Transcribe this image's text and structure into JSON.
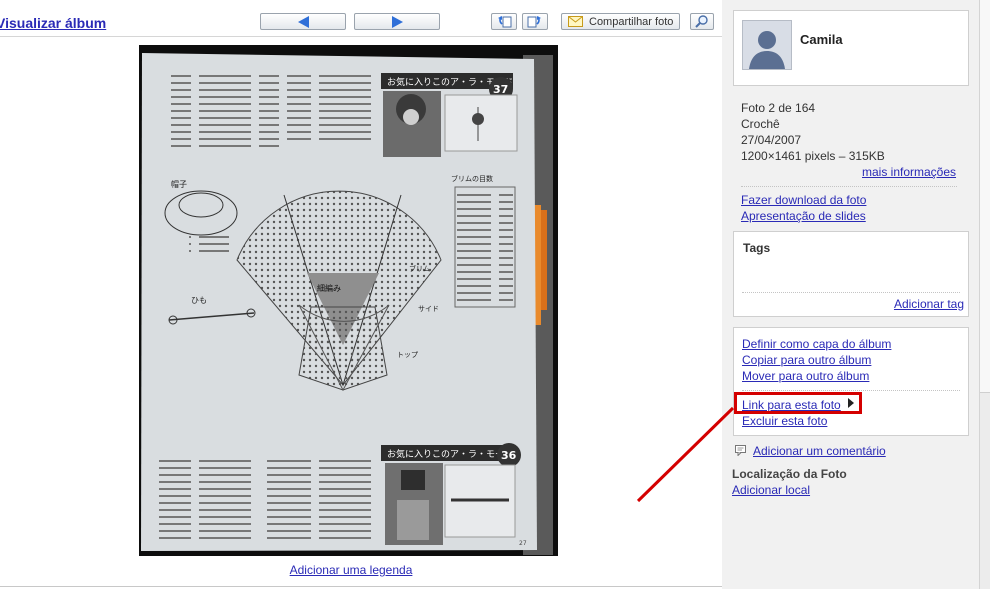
{
  "toolbar": {
    "back_label": "Visualizar álbum",
    "share_label": "Compartilhar foto"
  },
  "photo": {
    "caption_link": "Adicionar uma legenda",
    "page_texts": {
      "top_banner": "お気に入りこのア・ラ・モード",
      "top_number": "37",
      "bottom_banner": "お気に入りこのア・ラ・モード",
      "bottom_number": "36",
      "label_hat": "帽子",
      "label_himo": "ひも",
      "label_brim": "ブリム",
      "label_side": "サイド",
      "label_top": "トップ",
      "label_knit": "細編み",
      "label_brim_count": "ブリムの目数",
      "page_num": "27"
    }
  },
  "user": {
    "name": "Camila"
  },
  "info": {
    "count": "Foto 2 de 164",
    "album": "Crochê",
    "date": "27/04/2007",
    "size": "1200×1461 pixels – 315KB",
    "more_link": "mais informações"
  },
  "links": {
    "download": "Fazer download da foto",
    "slideshow": "Apresentação de slides"
  },
  "tags": {
    "heading": "Tags",
    "add_link": "Adicionar tag"
  },
  "actions": {
    "set_cover": "Definir como capa do álbum",
    "copy": "Copiar para outro álbum",
    "move": "Mover para outro álbum",
    "photo_link": "Link para esta foto",
    "delete": "Excluir esta foto"
  },
  "comment": {
    "add_link": "Adicionar um comentário"
  },
  "location": {
    "heading": "Localização da Foto",
    "add_link": "Adicionar local"
  },
  "colors": {
    "link": "#2a2ab6",
    "annotation": "#d40000",
    "nav_arrow": "#2f6fd8",
    "sidebar_bg": "#f1f1f1"
  },
  "icons": [
    "arrow-left-icon",
    "arrow-right-icon",
    "rotate-left-icon",
    "rotate-right-icon",
    "envelope-icon",
    "zoom-icon",
    "avatar-icon",
    "comment-icon",
    "triangle-right-icon"
  ]
}
